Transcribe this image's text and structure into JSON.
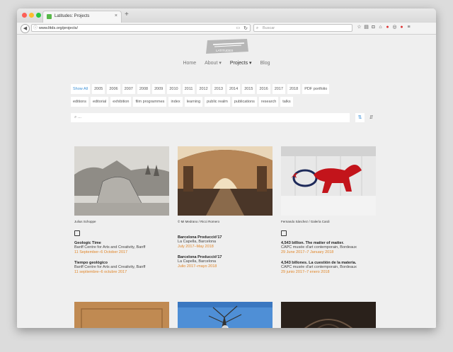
{
  "browser": {
    "tab_title": "Latitudes: Projects",
    "url": "www.lttds.org/projects/",
    "search_placeholder": "Buscar",
    "new_tab": "+"
  },
  "site": {
    "logo_text": "LATITUDES",
    "nav": [
      "Home",
      "About ▾",
      "Projects ▾",
      "Blog"
    ],
    "years": [
      "Show All",
      "2005",
      "2006",
      "2007",
      "2008",
      "2009",
      "2010",
      "2011",
      "2012",
      "2013",
      "2014",
      "2015",
      "2016",
      "2017",
      "2018",
      "PDF portfolio"
    ],
    "categories": [
      "editions",
      "editorial",
      "exhibition",
      "film programmes",
      "index",
      "learning",
      "public realm",
      "publications",
      "research",
      "talks"
    ],
    "search_placeholder": "..."
  },
  "cards": [
    {
      "caption": "Julius Schoppe",
      "items": [
        {
          "title": "Geologic Time",
          "place": "Banff Centre for Arts and Creativity, Banff",
          "date": "11 September–6 October 2017"
        },
        {
          "title": "Tiempo geológico",
          "place": "Banff Centre for Arts and Creativity, Banff",
          "date": "11 septiembre–6 octubre 2017"
        }
      ]
    },
    {
      "caption": "© Mi Medrano / Ricci Romero",
      "items": [
        {
          "title": "Barcelona Producció'17",
          "place": "La Capella, Barcelona",
          "date": "July 2017–May 2018"
        },
        {
          "title": "Barcelona Producció'17",
          "place": "La Capella, Barcelona",
          "date": "Julio 2017–mayo 2018"
        }
      ]
    },
    {
      "caption": "Fernando Sánchez / Galería Cardi",
      "items": [
        {
          "title": "4,543 billion. The matter of matter.",
          "place": "CAPC musée d'art contemporain, Bordeaux",
          "date": "29 June 2017–7 January 2018"
        },
        {
          "title": "4,543 billones. La cuestión de la materia.",
          "place": "CAPC musée d'art contemporain, Bordeaux",
          "date": "29 junio 2017–7 enero 2018"
        }
      ]
    }
  ]
}
